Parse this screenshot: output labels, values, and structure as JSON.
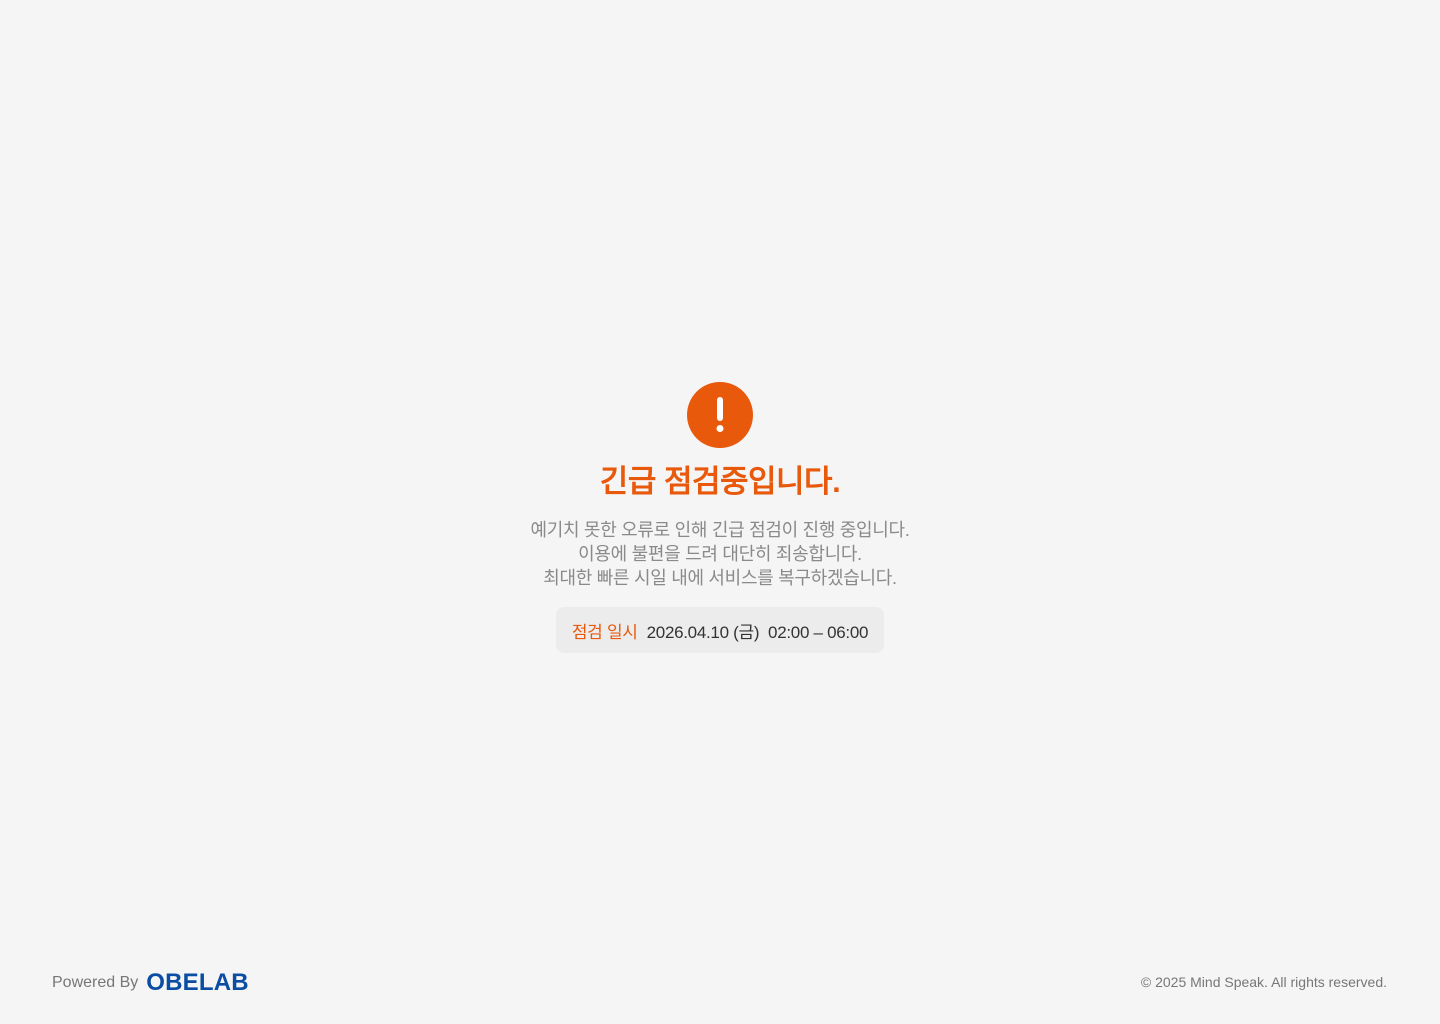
{
  "notice": {
    "icon": "exclamation-icon",
    "title": "긴급 점검중입니다.",
    "message_lines": [
      "예기치 못한 오류로 인해 긴급 점검이 진행 중입니다.",
      "이용에 불편을 드려 대단히 죄송합니다.",
      "최대한 빠른 시일 내에 서비스를 복구하겠습니다."
    ],
    "schedule": {
      "label": "점검 일시",
      "datetime": "2026.04.10 (금)  02:00 – 06:00"
    }
  },
  "footer": {
    "powered_by": "Powered By",
    "brand": "OBELAB",
    "copyright": "© 2025 Mind Speak. All rights reserved."
  },
  "colors": {
    "accent": "#e8590c",
    "brand": "#0b4da2",
    "background": "#f5f5f5"
  }
}
